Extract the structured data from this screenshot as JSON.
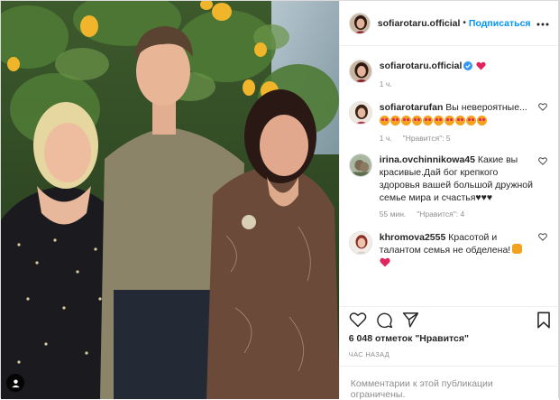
{
  "post": {
    "author": "sofiarotaru.official",
    "follow_label": "Подписаться",
    "separator": "•",
    "caption_time": "1 ч.",
    "likes": "6 048 отметок \"Нравится\"",
    "posted_ago": "ЧАС НАЗАД",
    "comments_limited": "Комментарии к этой публикации ограничены."
  },
  "comments": [
    {
      "username": "sofiarotarufan",
      "text": "Вы невероятные...",
      "time": "1 ч.",
      "likes": "\"Нравится\": 5"
    },
    {
      "username": "irina.ovchinnikowa45",
      "text": "Какие вы красивые.Дай бог крепкого здоровья вашей большой дружной семье мира и счастья♥♥♥",
      "time": "55 мин.",
      "likes": "\"Нравится\": 4"
    },
    {
      "username": "khromova2555",
      "text": "Красотой и талантом семья не обделена!"
    }
  ],
  "icons": {
    "verified": "verified-badge-icon",
    "heart": "heart-icon",
    "comment": "comment-icon",
    "share": "share-icon",
    "save": "bookmark-icon",
    "more": "more-options-icon",
    "tag": "user-tag-icon"
  },
  "colors": {
    "accent": "#0095f6",
    "heart_red": "#ed4956",
    "muted": "#8e8e8e",
    "text": "#262626"
  }
}
